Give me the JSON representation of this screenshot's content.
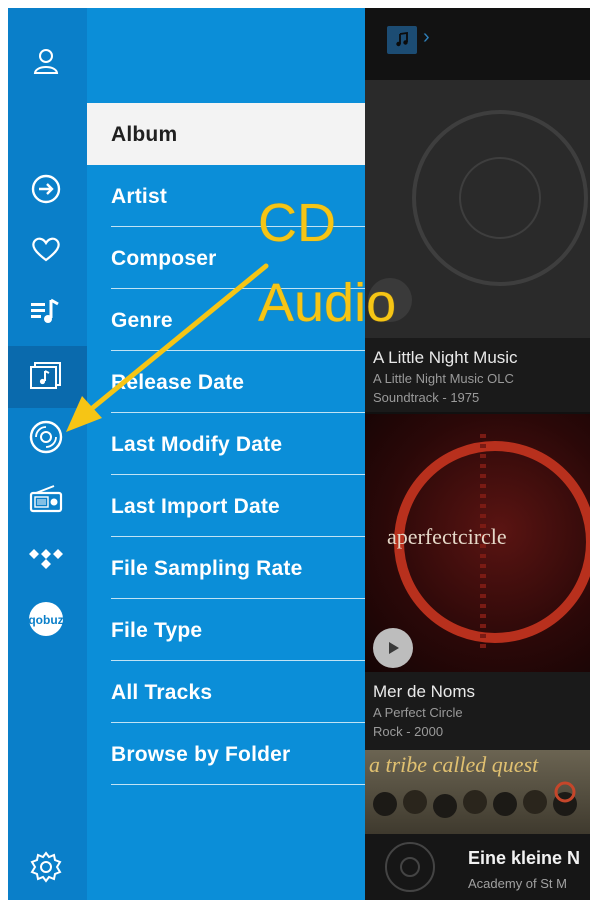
{
  "menu": {
    "items": [
      {
        "label": "Album"
      },
      {
        "label": "Artist"
      },
      {
        "label": "Composer"
      },
      {
        "label": "Genre"
      },
      {
        "label": "Release Date"
      },
      {
        "label": "Last Modify Date"
      },
      {
        "label": "Last Import Date"
      },
      {
        "label": "File Sampling Rate"
      },
      {
        "label": "File Type"
      },
      {
        "label": "All Tracks"
      },
      {
        "label": "Browse by Folder"
      }
    ]
  },
  "rail": {
    "icons": [
      "profile-icon",
      "import-arrow-icon",
      "heart-icon",
      "playlist-icon",
      "music-library-icon",
      "cd-icon",
      "radio-icon",
      "tidal-icon",
      "qobuz-icon",
      "settings-icon"
    ],
    "qobuz_text": "qobuz"
  },
  "albums": [
    {
      "title": "A Little Night Music",
      "line1": "A Little Night Music OLC",
      "line2": "Soundtrack - 1975"
    },
    {
      "title": "Mer de Noms",
      "line1": "A Perfect Circle",
      "line2": "Rock - 2000",
      "art_text": "aperfectcircle"
    },
    {
      "art_text": "a tribe called quest"
    }
  ],
  "now_playing": {
    "title": "Eine kleine N",
    "subtitle": "Academy of St M"
  },
  "annotation": {
    "line1": "CD",
    "line2": "Audio"
  },
  "colors": {
    "rail": "#0a7fc9",
    "menu": "#0b8ed8",
    "annotation": "#f6c515"
  }
}
